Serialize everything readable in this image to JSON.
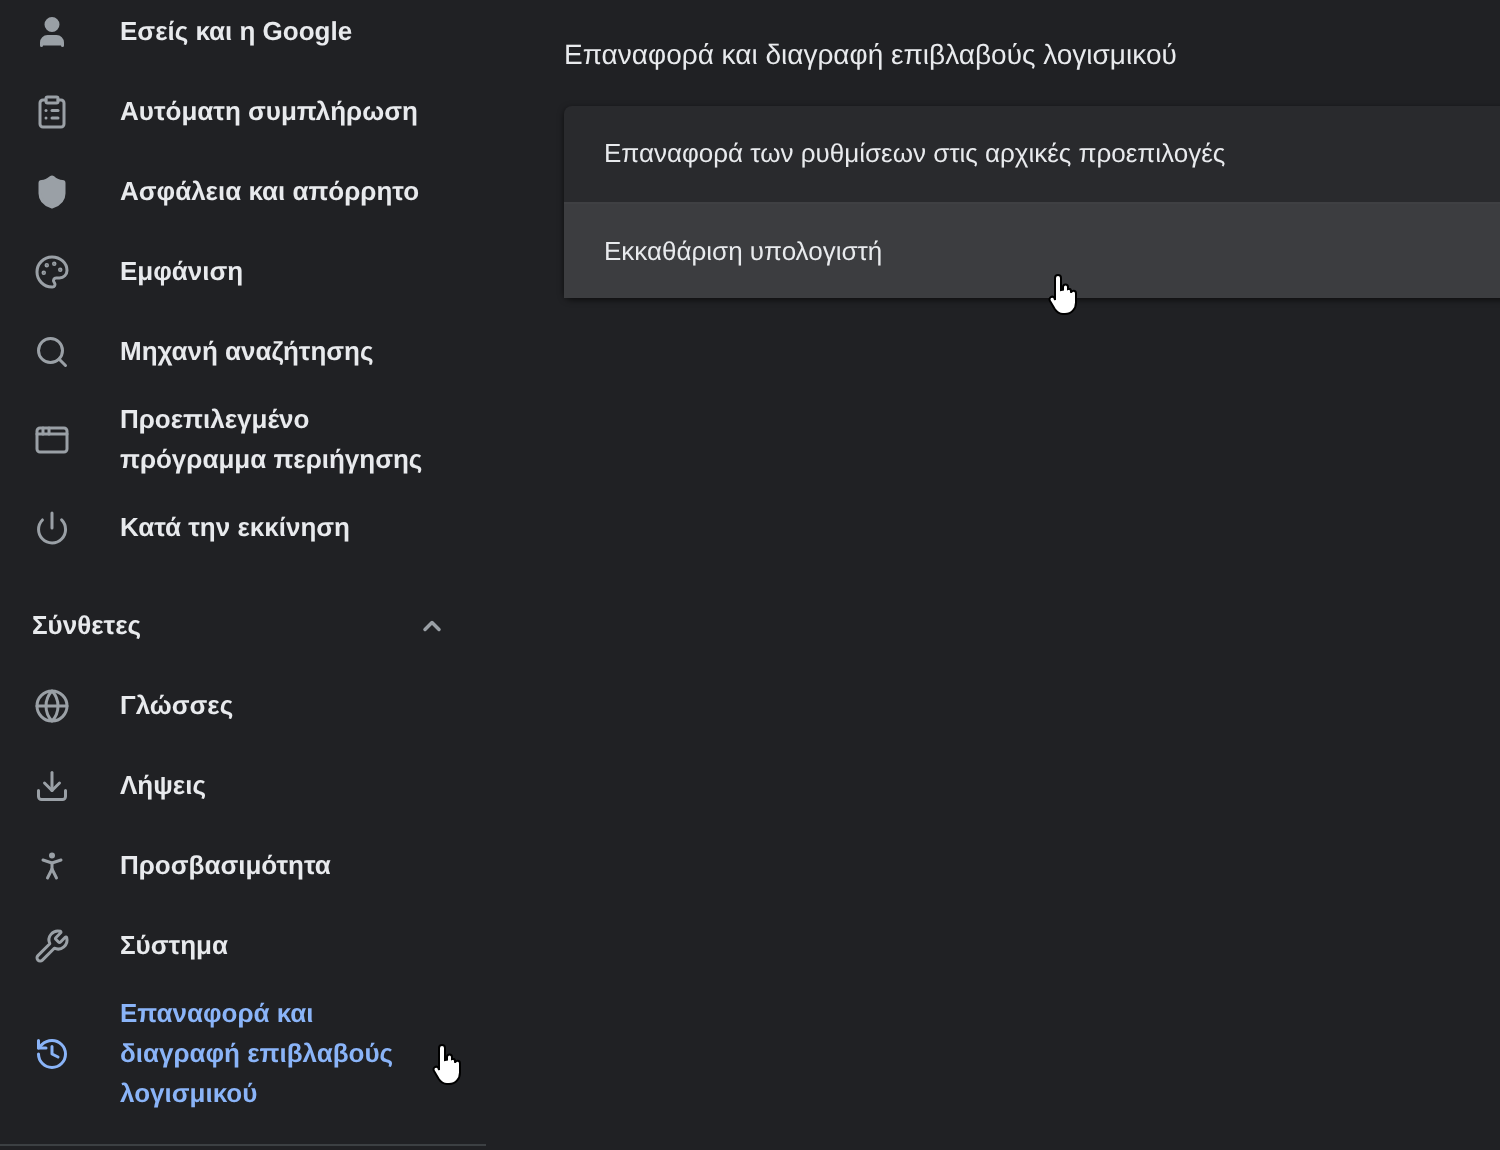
{
  "sidebar": {
    "items": [
      {
        "label": "Εσείς και η Google",
        "selected": false
      },
      {
        "label": "Αυτόματη συμπλήρωση",
        "selected": false
      },
      {
        "label": "Ασφάλεια και απόρρητο",
        "selected": false
      },
      {
        "label": "Εμφάνιση",
        "selected": false
      },
      {
        "label": "Μηχανή αναζήτησης",
        "selected": false
      },
      {
        "label": "Προεπιλεγμένο πρόγραμμα περιήγησης",
        "selected": false
      },
      {
        "label": "Κατά την εκκίνηση",
        "selected": false
      }
    ],
    "advanced": {
      "label": "Σύνθετες",
      "expanded": true,
      "items": [
        {
          "label": "Γλώσσες",
          "selected": false
        },
        {
          "label": "Λήψεις",
          "selected": false
        },
        {
          "label": "Προσβασιμότητα",
          "selected": false
        },
        {
          "label": "Σύστημα",
          "selected": false
        },
        {
          "label": "Επαναφορά και διαγραφή επιβλαβούς λογισμικού",
          "selected": true
        }
      ]
    }
  },
  "main": {
    "title": "Επαναφορά και διαγραφή επιβλαβούς λογισμικού",
    "rows": [
      {
        "label": "Επαναφορά των ρυθμίσεων στις αρχικές προεπιλογές",
        "hovered": false
      },
      {
        "label": "Εκκαθάριση υπολογιστή",
        "hovered": true
      }
    ]
  }
}
